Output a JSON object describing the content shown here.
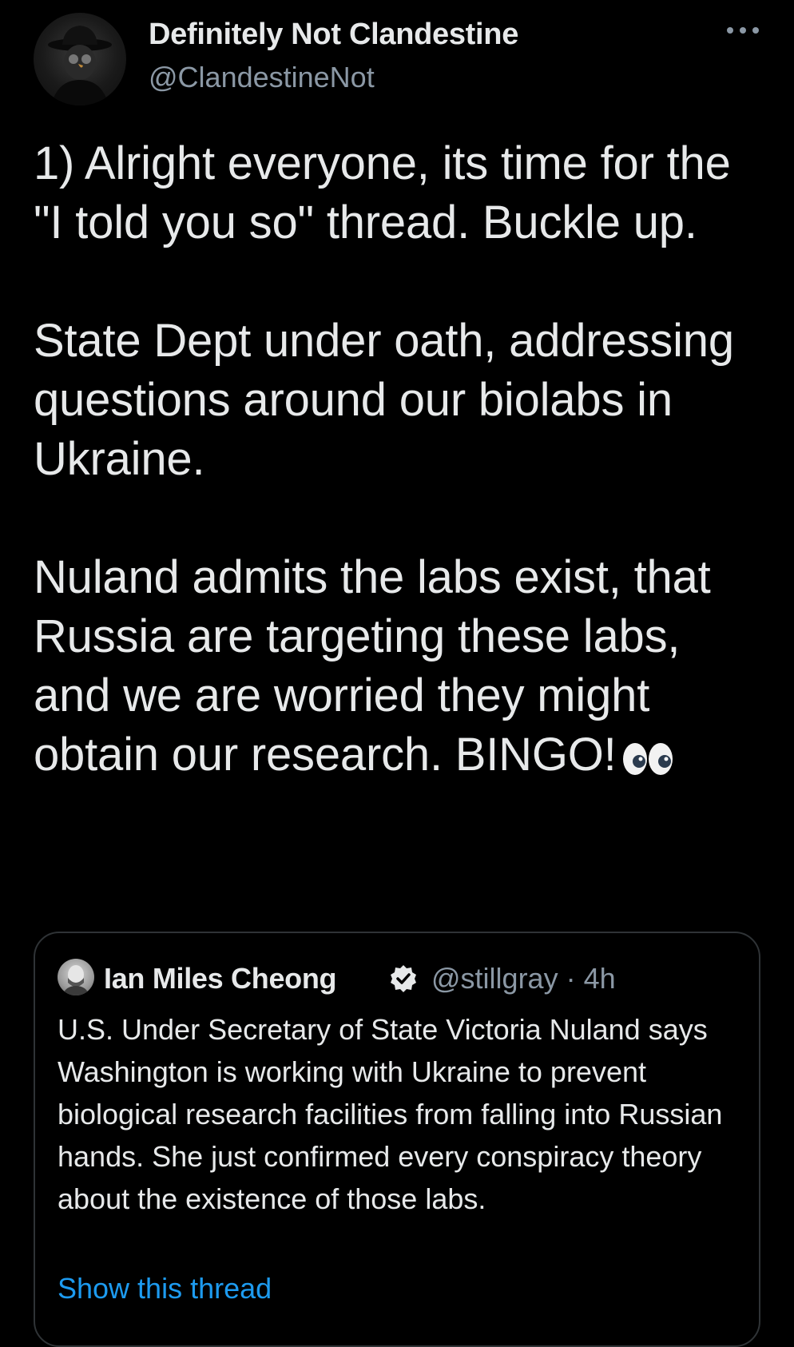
{
  "author": {
    "display_name": "Definitely Not Clandestine",
    "handle": "@ClandestineNot"
  },
  "tweet": {
    "paragraphs": [
      "1) Alright everyone, its time for the \"I told you so\" thread. Buckle up.",
      "State Dept under oath, addressing questions around our biolabs in Ukraine.",
      "Nuland admits the labs exist, that Russia are targeting these labs, and we are worried they might obtain our research. BINGO!"
    ],
    "emoji": "eyes-emoji"
  },
  "quoted_tweet": {
    "display_name": "Ian Miles Cheong",
    "verified": true,
    "meta": "@stillgray · 4h",
    "text": "U.S. Under Secretary of State Victoria Nuland says Washington is working with Ukraine to prevent biological research facilities from falling into Russian hands. She just confirmed every conspiracy theory about the existence of those labs.",
    "show_thread_label": "Show this thread"
  },
  "colors": {
    "background": "#000000",
    "text_primary": "#e7e9ea",
    "text_secondary": "#8b98a5",
    "link": "#1d9bf0",
    "border": "#2f3336"
  },
  "icons": {
    "more": "more-horizontal-icon",
    "verified": "verified-badge-icon"
  }
}
